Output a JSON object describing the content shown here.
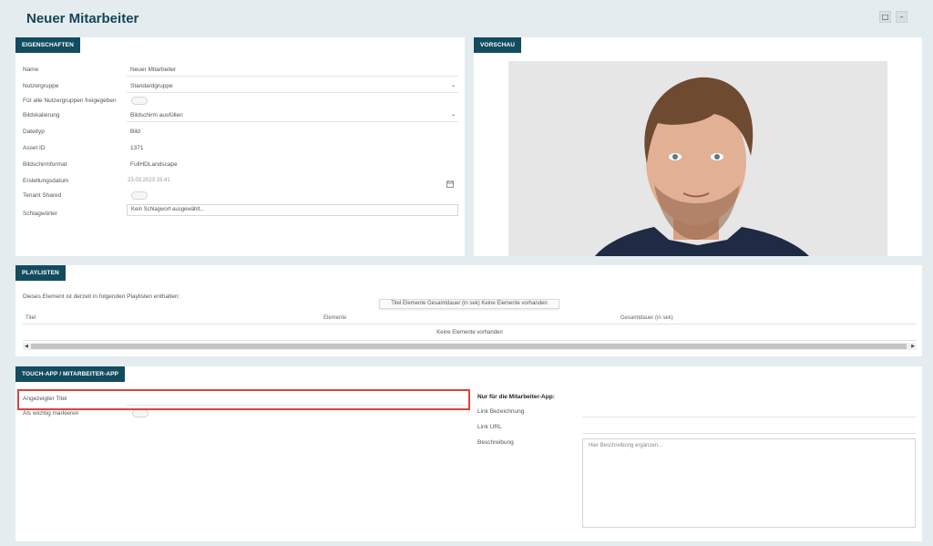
{
  "page": {
    "title": "Neuer Mitarbeiter"
  },
  "top_icons": [
    "chat-icon",
    "minimize-icon"
  ],
  "eigenschaften": {
    "tab": "EIGENSCHAFTEN",
    "name_label": "Name",
    "name_value": "Neuer Mitarbeiter",
    "nutzergruppe_label": "Nutzergruppe",
    "nutzergruppe_value": "Standardgruppe",
    "freigegeben_label": "Für alle Nutzergruppen freigegeben",
    "bildskalierung_label": "Bildskalierung",
    "bildskalierung_value": "Bildschirm ausfüllen",
    "dateityp_label": "Dateityp",
    "dateityp_value": "Bild",
    "asset_id_label": "Asset ID",
    "asset_id_value": "1371",
    "bildschirmformat_label": "Bildschirmformat",
    "bildschirmformat_value": "FullHDLandscape",
    "erstellungsdatum_label": "Erstellungsdatum",
    "erstellungsdatum_value": "23.03.2023 15:41",
    "tenant_label": "Tenant Shared",
    "schlagwoerter_label": "Schlagwörter",
    "schlagwoerter_placeholder": "Kein Schlagwort ausgewählt..."
  },
  "vorschau": {
    "tab": "VORSCHAU"
  },
  "playlisten": {
    "tab": "PLAYLISTEN",
    "description": "Dieses Element ist derzeit in folgenden Playlisten enthalten:",
    "tooltip": "Titel Elemente Gesamtdauer (in sek) Keine Elemente vorhanden",
    "columns": [
      "Titel",
      "Elemente",
      "Gesamtdauer (in sek)"
    ],
    "empty": "Keine Elemente vorhanden"
  },
  "touch_app": {
    "tab": "TOUCH-APP / MITARBEITER-APP",
    "angezeigter_titel_label": "Angezeigter Titel",
    "wichtig_label": "Als wichtig markieren",
    "nur_label": "Nur für die Mitarbeiter-App:",
    "link_bezeichnung_label": "Link Bezeichnung",
    "link_url_label": "Link URL",
    "beschreibung_label": "Beschreibung",
    "beschreibung_placeholder": "Hier Beschreibung ergänzen..."
  }
}
